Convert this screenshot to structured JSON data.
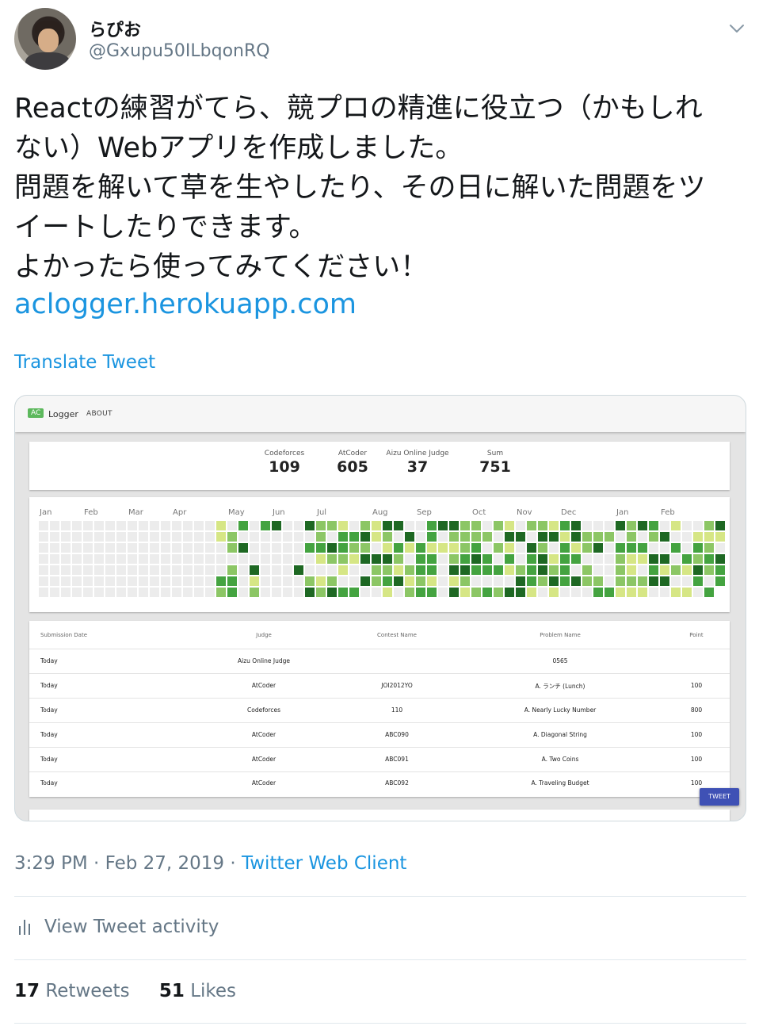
{
  "user": {
    "display_name": "らぴお",
    "handle": "@Gxupu50ILbqonRQ"
  },
  "tweet": {
    "lines": [
      "Reactの練習がてら、競プロの精進に役立つ（かもしれ",
      "ない）Webアプリを作成しました。",
      "問題を解いて草を生やしたり、その日に解いた問題をツ",
      "イートしたりできます。",
      "よかったら使ってみてください！"
    ],
    "link": "aclogger.herokuapp.com",
    "translate_label": "Translate Tweet"
  },
  "app": {
    "logo_badge": "AC",
    "logo_text": "Logger",
    "nav_about": "ABOUT",
    "stats": [
      {
        "label": "Codeforces",
        "value": "109"
      },
      {
        "label": "AtCoder",
        "value": "605"
      },
      {
        "label": "Aizu Online Judge",
        "value": "37"
      },
      {
        "label": "Sum",
        "value": "751"
      }
    ],
    "months": [
      "Jan",
      "Feb",
      "Mar",
      "Apr",
      "May",
      "Jun",
      "Jul",
      "Aug",
      "Sep",
      "Oct",
      "Nov",
      "Dec",
      "Jan",
      "Feb"
    ],
    "heatmap_colors": [
      "#ececec",
      "#d6e685",
      "#8cc665",
      "#44a340",
      "#1e6823"
    ],
    "table": {
      "headers": [
        "Submission Date",
        "Judge",
        "Contest Name",
        "Problem Name",
        "Point"
      ],
      "rows": [
        [
          "Today",
          "Aizu Online Judge",
          "",
          "0565",
          ""
        ],
        [
          "Today",
          "AtCoder",
          "JOI2012YO",
          "A. ランチ (Lunch)",
          "100"
        ],
        [
          "Today",
          "Codeforces",
          "110",
          "A. Nearly Lucky Number",
          "800"
        ],
        [
          "Today",
          "AtCoder",
          "ABC090",
          "A. Diagonal String",
          "100"
        ],
        [
          "Today",
          "AtCoder",
          "ABC091",
          "A. Two Coins",
          "100"
        ],
        [
          "Today",
          "AtCoder",
          "ABC092",
          "A. Traveling Budget",
          "100"
        ]
      ]
    },
    "tweet_button": "TWEET"
  },
  "meta": {
    "time_date": "3:29 PM · Feb 27, 2019 · ",
    "client": "Twitter Web Client",
    "view_activity": "View Tweet activity",
    "retweets_count": "17",
    "retweets_label": " Retweets",
    "likes_count": "51",
    "likes_label": " Likes"
  }
}
